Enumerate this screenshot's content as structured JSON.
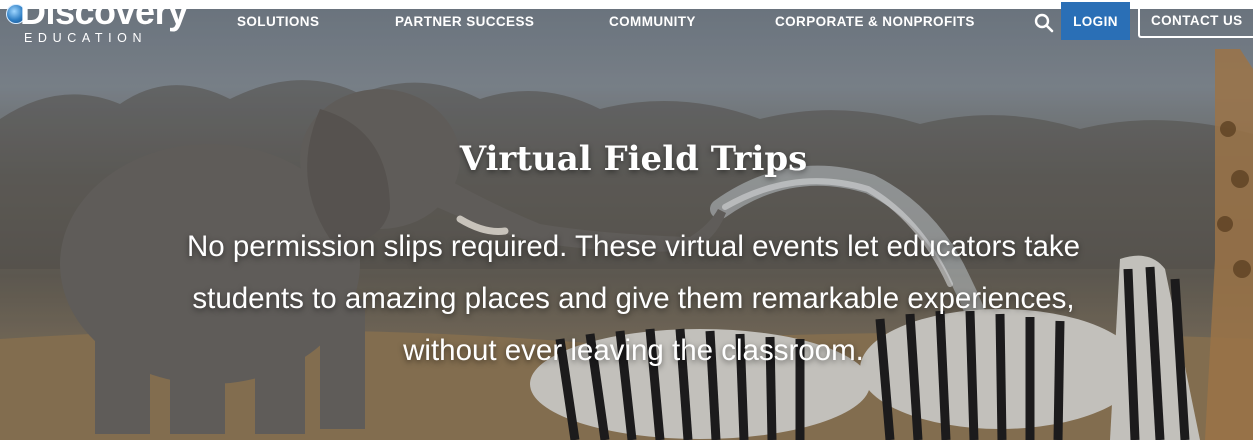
{
  "brand": {
    "name": "Discovery",
    "sub": "EDUCATION"
  },
  "nav": {
    "items": [
      {
        "label": "SOLUTIONS"
      },
      {
        "label": "PARTNER SUCCESS"
      },
      {
        "label": "COMMUNITY"
      },
      {
        "label": "CORPORATE & NONPROFITS"
      }
    ],
    "search_icon": "search-icon",
    "login_label": "LOGIN",
    "contact_label": "CONTACT US"
  },
  "hero": {
    "title": "Virtual Field Trips",
    "description": "No permission slips required. These virtual events let educators take students to amazing places and give them remarkable experiences, without ever leaving the classroom.",
    "background": "photo of an elephant spraying water beside a herd of zebras"
  },
  "colors": {
    "login_bg": "#2a6fb6",
    "text": "#ffffff"
  }
}
